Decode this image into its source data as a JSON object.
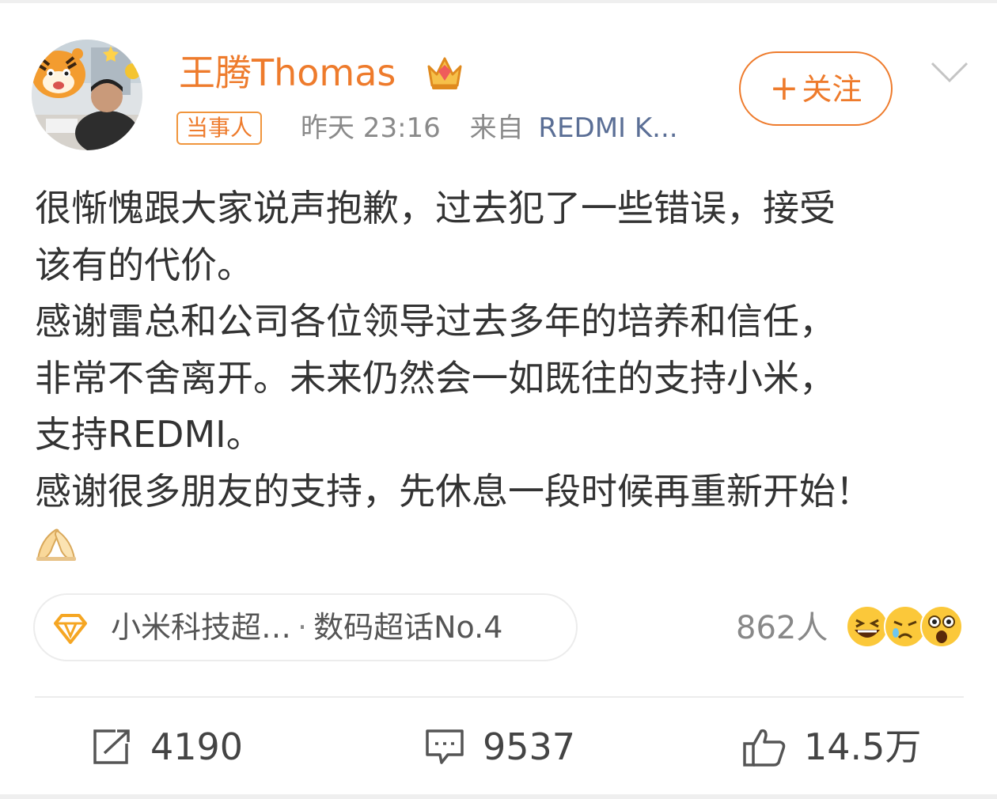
{
  "post": {
    "author": {
      "name": "王腾Thomas",
      "badge": "当事人",
      "avatar_icon": "avatar-photo-with-tiger-sticker",
      "crown_icon": "crown-icon"
    },
    "meta": {
      "time": "昨天 23:16",
      "source_prefix": "来自",
      "source": "REDMI K..."
    },
    "follow_button": {
      "plus": "+",
      "label": "关注"
    },
    "body_lines": [
      "很惭愧跟大家说声抱歉，过去犯了一些错误，接受",
      "该有的代价。",
      "感谢雷总和公司各位领导过去多年的培养和信任，",
      "非常不舍离开。未来仍然会一如既往的支持小米，",
      "支持REDMI。",
      "感谢很多朋友的支持，先休息一段时候再重新开始！"
    ],
    "body_emoji": "folded-hands-emoji",
    "topic": {
      "name": "小米科技超…",
      "separator": "·",
      "rank": "数码超话No.4",
      "icon": "diamond-icon"
    },
    "reactions": {
      "count": "862人",
      "emojis": [
        "laughing-emoji",
        "crying-emoji",
        "shocked-emoji"
      ]
    },
    "actions": {
      "repost": {
        "icon": "repost-icon",
        "count": "4190"
      },
      "comment": {
        "icon": "comment-icon",
        "count": "9537"
      },
      "like": {
        "icon": "thumbs-up-icon",
        "count": "14.5万"
      }
    }
  },
  "colors": {
    "accent_orange": "#ee7b2c",
    "source_blue": "#5b6f96",
    "text": "#333333",
    "muted": "#8a8a8a"
  }
}
